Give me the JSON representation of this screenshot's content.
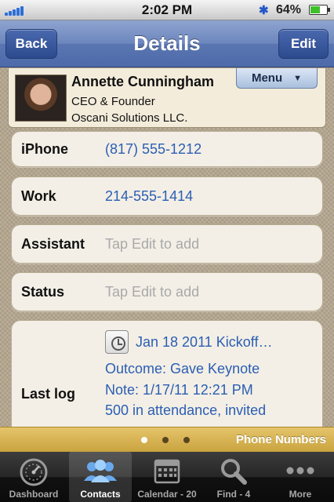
{
  "status_bar": {
    "time": "2:02 PM",
    "battery_percent": "64%",
    "battery_level": 0.64,
    "bluetooth_icon": "bluetooth-icon"
  },
  "navbar": {
    "back_label": "Back",
    "title": "Details",
    "edit_label": "Edit"
  },
  "contact": {
    "name": "Annette Cunningham",
    "role": "CEO & Founder",
    "company": "Oscani Solutions LLC.",
    "menu_label": "Menu",
    "menu_arrow": "▼"
  },
  "fields": {
    "iphone": {
      "label": "iPhone",
      "value": "(817) 555-1212"
    },
    "work": {
      "label": "Work",
      "value": "214-555-1414"
    },
    "assistant": {
      "label": "Assistant",
      "placeholder": "Tap Edit to add"
    },
    "status": {
      "label": "Status",
      "placeholder": "Tap Edit to add"
    }
  },
  "last_log": {
    "label": "Last log",
    "date_line": "Jan 18 2011  Kickoff…",
    "outcome": "Outcome: Gave Keynote",
    "note": "Note: 1/17/11 12:21 PM",
    "detail": "500 in attendance, invited"
  },
  "pager": {
    "label": "Phone Numbers",
    "pages": 3,
    "active_page": 1
  },
  "tabs": [
    {
      "label": "Dashboard",
      "icon": "speedometer-icon",
      "selected": false
    },
    {
      "label": "Contacts",
      "icon": "contacts-icon",
      "selected": true
    },
    {
      "label": "Calendar - 20",
      "icon": "calendar-icon",
      "selected": false
    },
    {
      "label": "Find - 4",
      "icon": "magnifier-icon",
      "selected": false
    },
    {
      "label": "More",
      "icon": "more-icon",
      "selected": false
    }
  ]
}
